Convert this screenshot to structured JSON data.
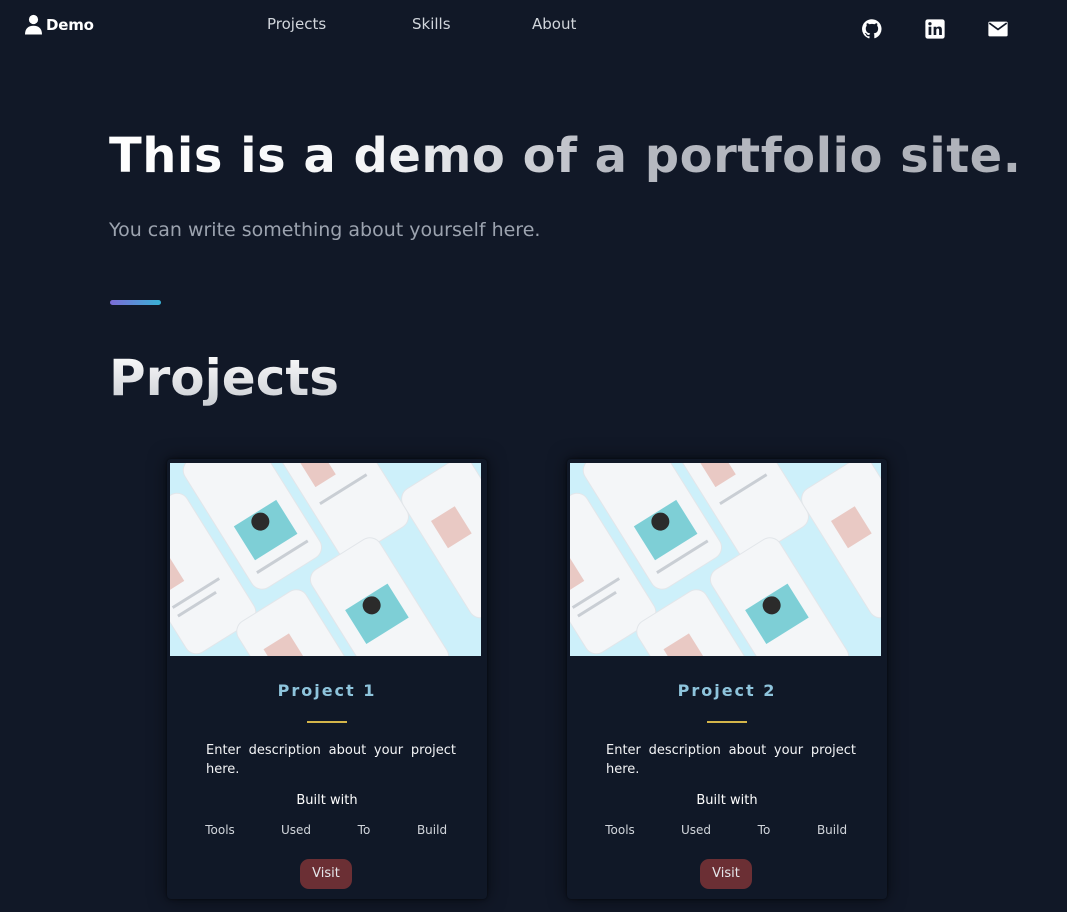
{
  "nav": {
    "brand": "Demo",
    "links": [
      "Projects",
      "Skills",
      "About"
    ],
    "social": [
      "github-icon",
      "linkedin-icon",
      "mail-icon"
    ]
  },
  "hero": {
    "title": "This is a demo of a portfolio site.",
    "subtitle": "You can write something about yourself here."
  },
  "projects": {
    "heading": "Projects",
    "cards": [
      {
        "title": "Project 1",
        "description": "Enter description about your project here.",
        "built_with": "Built with",
        "tools": [
          "Tools",
          "Used",
          "To",
          "Build"
        ],
        "button": "Visit"
      },
      {
        "title": "Project 2",
        "description": "Enter description about your project here.",
        "built_with": "Built with",
        "tools": [
          "Tools",
          "Used",
          "To",
          "Build"
        ],
        "button": "Visit"
      }
    ]
  },
  "colors": {
    "background": "#111827",
    "card_title": "#8ec4dc",
    "accent_rule": "#d4b54a",
    "visit_button": "#6b2f34"
  }
}
